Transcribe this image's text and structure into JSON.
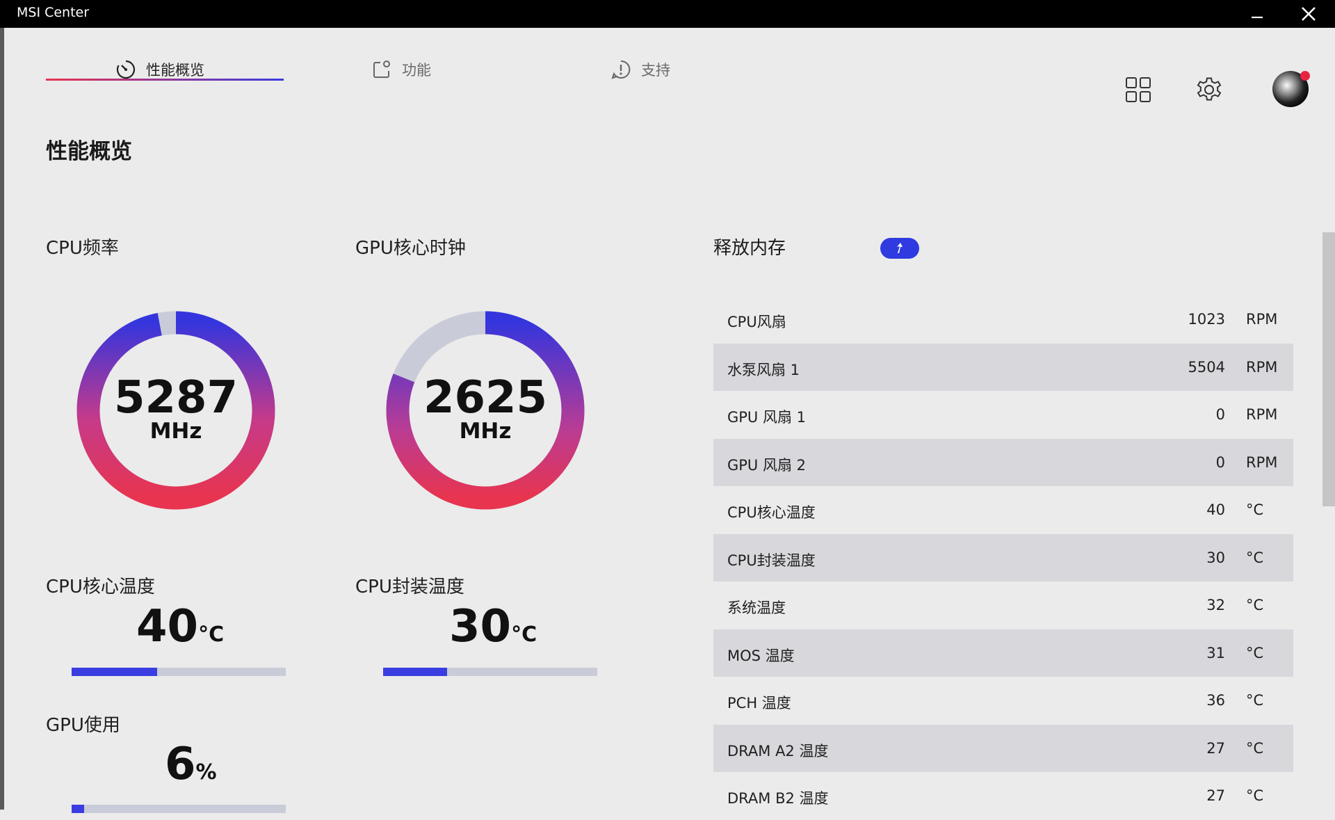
{
  "window": {
    "title": "MSI Center"
  },
  "tabs": [
    {
      "label": "性能概览",
      "icon": "gauge-icon",
      "active": true
    },
    {
      "label": "功能",
      "icon": "function-icon",
      "active": false
    },
    {
      "label": "支持",
      "icon": "support-icon",
      "active": false
    }
  ],
  "header_icons": [
    "apps-grid-icon",
    "gear-icon",
    "avatar"
  ],
  "page_title": "性能概览",
  "gauges": {
    "cpu_freq": {
      "label": "CPU频率",
      "value": "5287",
      "unit": "MHz",
      "fill_fraction": 0.97
    },
    "gpu_clock": {
      "label": "GPU核心时钟",
      "value": "2625",
      "unit": "MHz",
      "fill_fraction": 0.81
    }
  },
  "stats": {
    "cpu_core_temp": {
      "label": "CPU核心温度",
      "value": "40",
      "unit": "°C",
      "fill_fraction": 0.4
    },
    "cpu_pkg_temp": {
      "label": "CPU封装温度",
      "value": "30",
      "unit": "°C",
      "fill_fraction": 0.3
    },
    "gpu_usage": {
      "label": "GPU使用",
      "value": "6",
      "unit": "%",
      "fill_fraction": 0.06
    }
  },
  "free_memory": {
    "label": "释放内存",
    "icon": "boost-arrow-icon"
  },
  "sensors": [
    {
      "name": "CPU风扇",
      "value": "1023",
      "unit": "RPM"
    },
    {
      "name": "水泵风扇 1",
      "value": "5504",
      "unit": "RPM"
    },
    {
      "name": "GPU 风扇 1",
      "value": "0",
      "unit": "RPM"
    },
    {
      "name": "GPU 风扇 2",
      "value": "0",
      "unit": "RPM"
    },
    {
      "name": "CPU核心温度",
      "value": "40",
      "unit": "°C"
    },
    {
      "name": "CPU封装温度",
      "value": "30",
      "unit": "°C"
    },
    {
      "name": "系统温度",
      "value": "32",
      "unit": "°C"
    },
    {
      "name": "MOS 温度",
      "value": "31",
      "unit": "°C"
    },
    {
      "name": "PCH 温度",
      "value": "36",
      "unit": "°C"
    },
    {
      "name": "DRAM A2 温度",
      "value": "27",
      "unit": "°C"
    },
    {
      "name": "DRAM B2 温度",
      "value": "27",
      "unit": "°C"
    }
  ],
  "colors": {
    "accent_red": "#e8344f",
    "accent_blue": "#3b3be0",
    "track": "#c9ccd8",
    "row_alt": "#d7d7dc"
  }
}
